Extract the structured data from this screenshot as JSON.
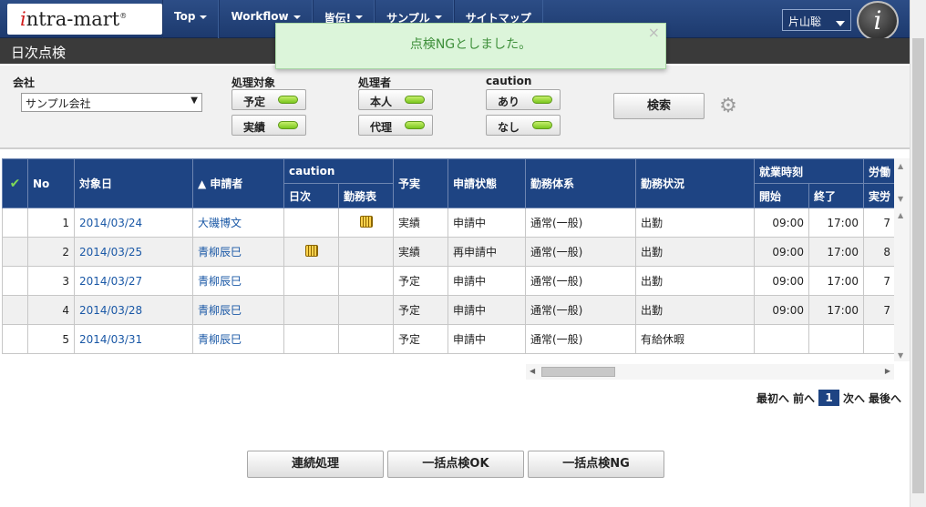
{
  "header": {
    "logo_prefix": "i",
    "logo_rest": "ntra-mart",
    "logo_mark": "®",
    "nav": [
      {
        "label": "Top",
        "has_dropdown": true
      },
      {
        "label": "Workflow",
        "has_dropdown": true
      },
      {
        "label": "皆伝!",
        "has_dropdown": true
      },
      {
        "label": "サンプル",
        "has_dropdown": true
      },
      {
        "label": "サイトマップ",
        "has_dropdown": false
      }
    ],
    "user": "片山聡",
    "brand_letter": "i"
  },
  "page_title": "日次点検",
  "toast": {
    "message": "点検NGとしました。",
    "close": "×"
  },
  "filters": {
    "company_label": "会社",
    "company_value": "サンプル会社",
    "target_label": "処理対象",
    "target_options": [
      "予定",
      "実績"
    ],
    "processor_label": "処理者",
    "processor_options": [
      "本人",
      "代理"
    ],
    "caution_label": "caution",
    "caution_options": [
      "あり",
      "なし"
    ],
    "search_label": "検索",
    "toggle_color": "#7bc71e"
  },
  "table": {
    "headers_top": [
      "No",
      "対象日",
      "▲ 申請者",
      "caution",
      "予実",
      "申請状態",
      "勤務体系",
      "勤務状況",
      "就業時刻",
      "労働"
    ],
    "headers_sub": [
      "日次",
      "勤務表",
      "開始",
      "終了",
      "実労"
    ],
    "rows": [
      {
        "no": "1",
        "date": "2014/03/24",
        "applicant": "大磯博文",
        "daily_caution": false,
        "sheet_caution": true,
        "plan": "実績",
        "status": "申請中",
        "system": "通常(一般)",
        "condition": "出勤",
        "start": "09:00",
        "end": "17:00",
        "extra": "7"
      },
      {
        "no": "2",
        "date": "2014/03/25",
        "applicant": "青柳辰巳",
        "daily_caution": true,
        "sheet_caution": false,
        "plan": "実績",
        "status": "再申請中",
        "system": "通常(一般)",
        "condition": "出勤",
        "start": "09:00",
        "end": "17:00",
        "extra": "8"
      },
      {
        "no": "3",
        "date": "2014/03/27",
        "applicant": "青柳辰巳",
        "daily_caution": false,
        "sheet_caution": false,
        "plan": "予定",
        "status": "申請中",
        "system": "通常(一般)",
        "condition": "出勤",
        "start": "09:00",
        "end": "17:00",
        "extra": "7"
      },
      {
        "no": "4",
        "date": "2014/03/28",
        "applicant": "青柳辰巳",
        "daily_caution": false,
        "sheet_caution": false,
        "plan": "予定",
        "status": "申請中",
        "system": "通常(一般)",
        "condition": "出勤",
        "start": "09:00",
        "end": "17:00",
        "extra": "7"
      },
      {
        "no": "5",
        "date": "2014/03/31",
        "applicant": "青柳辰巳",
        "daily_caution": false,
        "sheet_caution": false,
        "plan": "予定",
        "status": "申請中",
        "system": "通常(一般)",
        "condition": "有給休暇",
        "start": "",
        "end": "",
        "extra": ""
      }
    ]
  },
  "pager": {
    "first": "最初へ",
    "prev": "前へ",
    "current": "1",
    "next": "次へ",
    "last": "最後へ"
  },
  "actions": {
    "batch": "連続処理",
    "ok": "一括点検OK",
    "ng": "一括点検NG"
  },
  "colors": {
    "nav_bg": "#1d3a6e",
    "header_bg": "#1e4483",
    "link": "#1a58a6",
    "toast_bg": "#dcf5da"
  }
}
